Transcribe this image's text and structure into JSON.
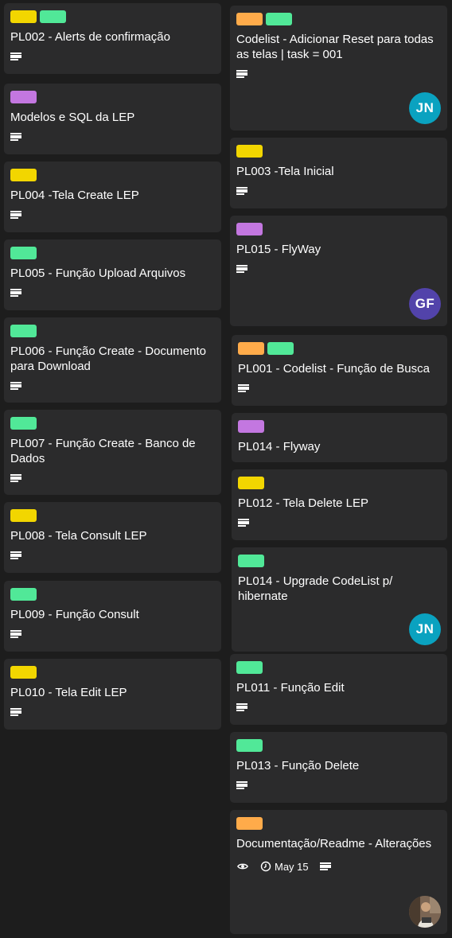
{
  "colors": {
    "yellow": "#f2d600",
    "green": "#51e898",
    "purple": "#c377e0",
    "orange": "#ffab4a",
    "jn_avatar": "#0aa2c0",
    "gf_avatar": "#5243aa"
  },
  "left_column": [
    {
      "title": "PL002 - Alerts de confirmação",
      "labels": [
        "yellow",
        "green"
      ],
      "icons": [
        "description-icon"
      ]
    },
    {
      "title": "Modelos e SQL da LEP",
      "labels": [
        "purple"
      ],
      "icons": [
        "description-icon"
      ]
    },
    {
      "title": "PL004 -Tela Create LEP",
      "labels": [
        "yellow"
      ],
      "icons": [
        "description-icon"
      ]
    },
    {
      "title": "PL005 - Função Upload Arquivos",
      "labels": [
        "green"
      ],
      "icons": [
        "description-icon"
      ]
    },
    {
      "title": "PL006 - Função Create - Documento para Download",
      "labels": [
        "green"
      ],
      "icons": [
        "description-icon"
      ]
    },
    {
      "title": "PL007 - Função Create - Banco de Dados",
      "labels": [
        "green"
      ],
      "icons": [
        "description-icon"
      ]
    },
    {
      "title": "PL008 - Tela Consult LEP",
      "labels": [
        "yellow"
      ],
      "icons": [
        "description-icon"
      ]
    },
    {
      "title": "PL009 - Função Consult",
      "labels": [
        "green"
      ],
      "icons": [
        "description-icon"
      ]
    },
    {
      "title": "PL010 - Tela Edit LEP",
      "labels": [
        "yellow"
      ],
      "icons": [
        "description-icon"
      ]
    }
  ],
  "right_column": [
    {
      "title": "Codelist - Adicionar Reset para todas as telas | task = 001",
      "labels": [
        "orange",
        "green"
      ],
      "icons": [
        "description-icon"
      ],
      "member": "JN"
    },
    {
      "title": "PL003 -Tela Inicial",
      "labels": [
        "yellow"
      ],
      "icons": [
        "description-icon"
      ]
    },
    {
      "title": "PL015 - FlyWay",
      "labels": [
        "purple"
      ],
      "icons": [
        "description-icon"
      ],
      "member": "GF"
    },
    {
      "title": "PL001 - Codelist - Função de Busca",
      "labels": [
        "orange",
        "green"
      ],
      "icons": [
        "description-icon"
      ]
    },
    {
      "title": "PL014 - Flyway",
      "labels": [
        "purple"
      ],
      "icons": []
    },
    {
      "title": "PL012 - Tela Delete LEP",
      "labels": [
        "yellow"
      ],
      "icons": [
        "description-icon"
      ]
    },
    {
      "title": "PL014 - Upgrade CodeList p/ hibernate",
      "labels": [
        "green"
      ],
      "icons": [],
      "member": "JN"
    },
    {
      "title": "PL011 - Função Edit",
      "labels": [
        "green"
      ],
      "icons": [
        "description-icon"
      ]
    },
    {
      "title": "PL013 - Função Delete",
      "labels": [
        "green"
      ],
      "icons": [
        "description-icon"
      ]
    },
    {
      "title": "Documentação/Readme - Alterações",
      "labels": [
        "orange"
      ],
      "icons": [
        "watch-icon",
        "due-date",
        "description-icon"
      ],
      "due_date": "May 15",
      "member": "photo"
    }
  ]
}
